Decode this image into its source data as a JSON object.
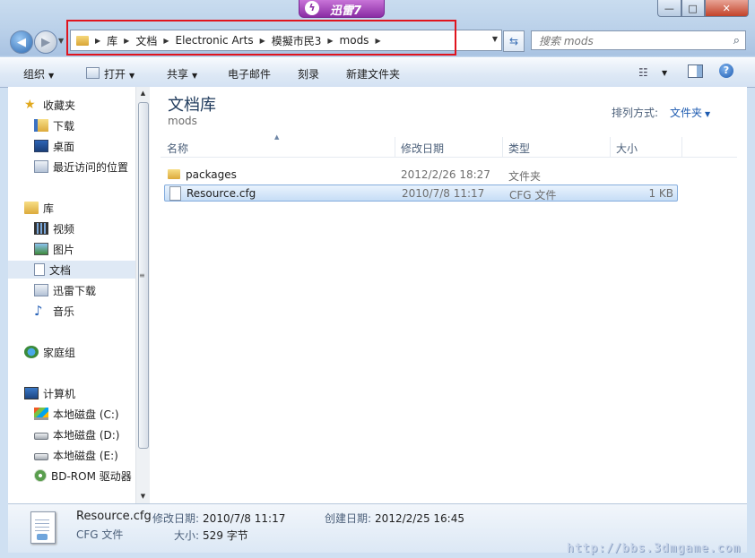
{
  "titlebar": {
    "brand_text": "迅雷7",
    "brand_logo_letter": "ϟ",
    "minimize": "—",
    "maximize": "□",
    "close": "✕"
  },
  "nav": {
    "back_glyph": "◀",
    "forward_glyph": "▶"
  },
  "address": {
    "breadcrumbs": [
      "库",
      "文档",
      "Electronic Arts",
      "模擬市民3",
      "mods"
    ]
  },
  "search": {
    "placeholder": "搜索 mods"
  },
  "toolbar": {
    "organize": "组织",
    "open": "打开",
    "share": "共享",
    "email": "电子邮件",
    "burn": "刻录",
    "new_folder": "新建文件夹"
  },
  "sidebar": {
    "favorites": {
      "label": "收藏夹",
      "items": [
        "下载",
        "桌面",
        "最近访问的位置"
      ]
    },
    "libraries": {
      "label": "库",
      "items": [
        "视频",
        "图片",
        "文档",
        "迅雷下载",
        "音乐"
      ]
    },
    "homegroup": "家庭组",
    "computer": {
      "label": "计算机",
      "items": [
        "本地磁盘 (C:)",
        "本地磁盘 (D:)",
        "本地磁盘 (E:)",
        "BD-ROM 驱动器"
      ]
    }
  },
  "content": {
    "library_title": "文档库",
    "library_subtitle": "mods",
    "arrange_label": "排列方式:",
    "arrange_value": "文件夹",
    "columns": [
      "名称",
      "修改日期",
      "类型",
      "大小"
    ],
    "files": [
      {
        "name": "packages",
        "date": "2012/2/26 18:27",
        "type": "文件夹",
        "size": "",
        "icon": "folder-icon"
      },
      {
        "name": "Resource.cfg",
        "date": "2010/7/8 11:17",
        "type": "CFG 文件",
        "size": "1 KB",
        "icon": "file-icon"
      }
    ]
  },
  "details": {
    "filename": "Resource.cfg",
    "filetype": "CFG 文件",
    "modified_label": "修改日期:",
    "modified_value": "2010/7/8 11:17",
    "created_label": "创建日期:",
    "created_value": "2012/2/25 16:45",
    "size_label": "大小:",
    "size_value": "529 字节"
  },
  "watermark": "http://bbs.3dmgame.com",
  "colors": {
    "selection": "#c6ddf6",
    "highlight_box": "#e0141e",
    "link_blue": "#1e5bb0"
  }
}
